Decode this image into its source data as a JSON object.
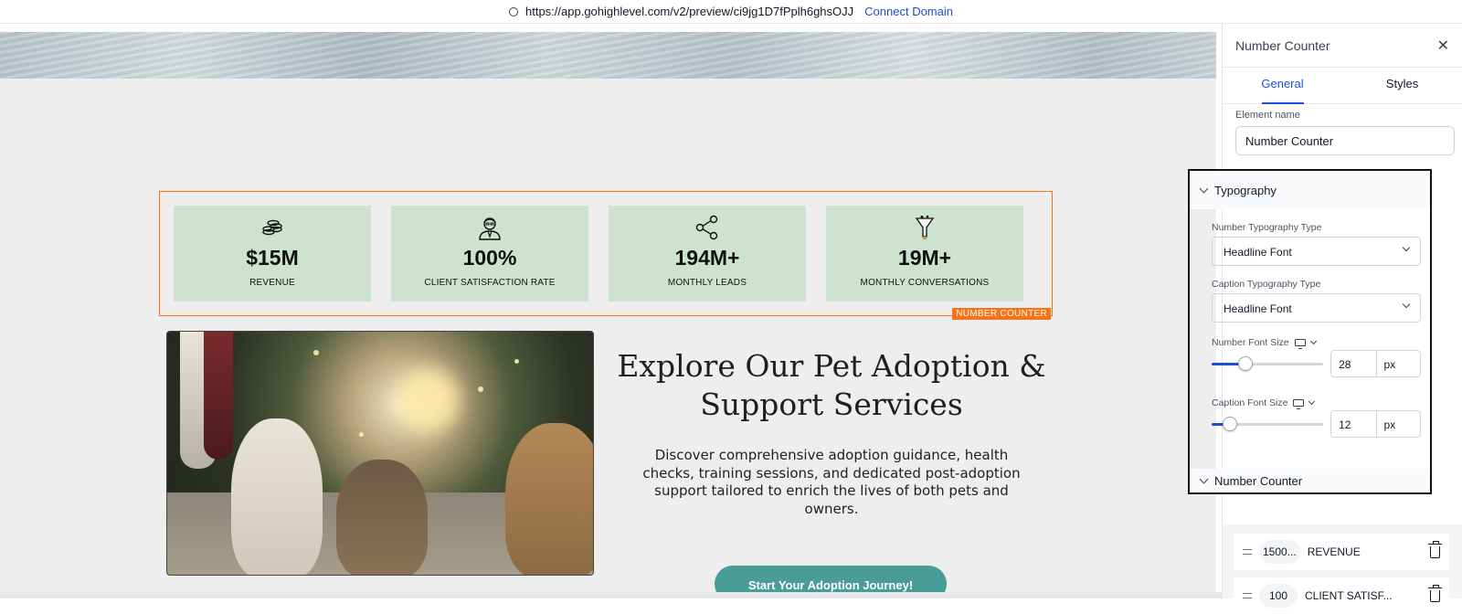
{
  "browser": {
    "url": "https://app.gohighlevel.com/v2/preview/ci9jg1D7fPplh6ghsOJJ",
    "connect_label": "Connect Domain"
  },
  "counter": {
    "tag": "NUMBER COUNTER",
    "items": [
      {
        "number": "$15M",
        "caption": "REVENUE",
        "icon": "coins-icon"
      },
      {
        "number": "100%",
        "caption": "CLIENT SATISFACTION RATE",
        "icon": "person-icon"
      },
      {
        "number": "194M+",
        "caption": "MONTHLY LEADS",
        "icon": "share-icon"
      },
      {
        "number": "19M+",
        "caption": "MONTHLY CONVERSATIONS",
        "icon": "funnel-icon"
      }
    ]
  },
  "section": {
    "headline": "Explore Our Pet Adoption & Support Services",
    "description": "Discover comprehensive adoption guidance, health checks, training sessions, and dedicated post-adoption support tailored to enrich the lives of both pets and owners.",
    "cta": "Start Your Adoption Journey!"
  },
  "panel": {
    "title": "Number Counter",
    "tabs": [
      "General",
      "Styles"
    ],
    "element_name_label": "Element name",
    "element_name_value": "Number Counter",
    "typography": {
      "title": "Typography",
      "number_type_label": "Number Typography Type",
      "number_type_value": "Headline Font",
      "caption_type_label": "Caption Typography Type",
      "caption_type_value": "Headline Font",
      "number_size_label": "Number Font Size",
      "number_size_value": "28",
      "number_size_unit": "px",
      "number_size_fraction": 0.29,
      "caption_size_label": "Caption Font Size",
      "caption_size_value": "12",
      "caption_size_unit": "px",
      "caption_size_fraction": 0.16
    },
    "number_counter_section": "Number Counter",
    "list": [
      {
        "value": "1500...",
        "label": "REVENUE"
      },
      {
        "value": "100",
        "label": "CLIENT SATISF..."
      }
    ]
  },
  "colors": {
    "accent": "#1d4ed8",
    "card_bg": "#cde3cf",
    "selection": "#f97316",
    "cta_bg": "#4a9c97"
  }
}
